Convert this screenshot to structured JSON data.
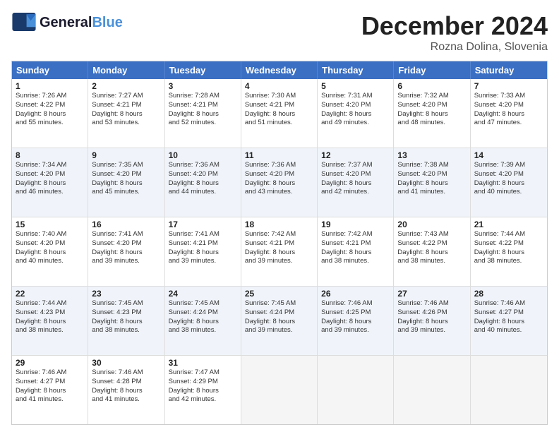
{
  "header": {
    "logo_line1": "General",
    "logo_line2": "Blue",
    "month": "December 2024",
    "location": "Rozna Dolina, Slovenia"
  },
  "days_of_week": [
    "Sunday",
    "Monday",
    "Tuesday",
    "Wednesday",
    "Thursday",
    "Friday",
    "Saturday"
  ],
  "weeks": [
    [
      {
        "day": 1,
        "lines": [
          "Sunrise: 7:26 AM",
          "Sunset: 4:22 PM",
          "Daylight: 8 hours",
          "and 55 minutes."
        ]
      },
      {
        "day": 2,
        "lines": [
          "Sunrise: 7:27 AM",
          "Sunset: 4:21 PM",
          "Daylight: 8 hours",
          "and 53 minutes."
        ]
      },
      {
        "day": 3,
        "lines": [
          "Sunrise: 7:28 AM",
          "Sunset: 4:21 PM",
          "Daylight: 8 hours",
          "and 52 minutes."
        ]
      },
      {
        "day": 4,
        "lines": [
          "Sunrise: 7:30 AM",
          "Sunset: 4:21 PM",
          "Daylight: 8 hours",
          "and 51 minutes."
        ]
      },
      {
        "day": 5,
        "lines": [
          "Sunrise: 7:31 AM",
          "Sunset: 4:20 PM",
          "Daylight: 8 hours",
          "and 49 minutes."
        ]
      },
      {
        "day": 6,
        "lines": [
          "Sunrise: 7:32 AM",
          "Sunset: 4:20 PM",
          "Daylight: 8 hours",
          "and 48 minutes."
        ]
      },
      {
        "day": 7,
        "lines": [
          "Sunrise: 7:33 AM",
          "Sunset: 4:20 PM",
          "Daylight: 8 hours",
          "and 47 minutes."
        ]
      }
    ],
    [
      {
        "day": 8,
        "lines": [
          "Sunrise: 7:34 AM",
          "Sunset: 4:20 PM",
          "Daylight: 8 hours",
          "and 46 minutes."
        ]
      },
      {
        "day": 9,
        "lines": [
          "Sunrise: 7:35 AM",
          "Sunset: 4:20 PM",
          "Daylight: 8 hours",
          "and 45 minutes."
        ]
      },
      {
        "day": 10,
        "lines": [
          "Sunrise: 7:36 AM",
          "Sunset: 4:20 PM",
          "Daylight: 8 hours",
          "and 44 minutes."
        ]
      },
      {
        "day": 11,
        "lines": [
          "Sunrise: 7:36 AM",
          "Sunset: 4:20 PM",
          "Daylight: 8 hours",
          "and 43 minutes."
        ]
      },
      {
        "day": 12,
        "lines": [
          "Sunrise: 7:37 AM",
          "Sunset: 4:20 PM",
          "Daylight: 8 hours",
          "and 42 minutes."
        ]
      },
      {
        "day": 13,
        "lines": [
          "Sunrise: 7:38 AM",
          "Sunset: 4:20 PM",
          "Daylight: 8 hours",
          "and 41 minutes."
        ]
      },
      {
        "day": 14,
        "lines": [
          "Sunrise: 7:39 AM",
          "Sunset: 4:20 PM",
          "Daylight: 8 hours",
          "and 40 minutes."
        ]
      }
    ],
    [
      {
        "day": 15,
        "lines": [
          "Sunrise: 7:40 AM",
          "Sunset: 4:20 PM",
          "Daylight: 8 hours",
          "and 40 minutes."
        ]
      },
      {
        "day": 16,
        "lines": [
          "Sunrise: 7:41 AM",
          "Sunset: 4:20 PM",
          "Daylight: 8 hours",
          "and 39 minutes."
        ]
      },
      {
        "day": 17,
        "lines": [
          "Sunrise: 7:41 AM",
          "Sunset: 4:21 PM",
          "Daylight: 8 hours",
          "and 39 minutes."
        ]
      },
      {
        "day": 18,
        "lines": [
          "Sunrise: 7:42 AM",
          "Sunset: 4:21 PM",
          "Daylight: 8 hours",
          "and 39 minutes."
        ]
      },
      {
        "day": 19,
        "lines": [
          "Sunrise: 7:42 AM",
          "Sunset: 4:21 PM",
          "Daylight: 8 hours",
          "and 38 minutes."
        ]
      },
      {
        "day": 20,
        "lines": [
          "Sunrise: 7:43 AM",
          "Sunset: 4:22 PM",
          "Daylight: 8 hours",
          "and 38 minutes."
        ]
      },
      {
        "day": 21,
        "lines": [
          "Sunrise: 7:44 AM",
          "Sunset: 4:22 PM",
          "Daylight: 8 hours",
          "and 38 minutes."
        ]
      }
    ],
    [
      {
        "day": 22,
        "lines": [
          "Sunrise: 7:44 AM",
          "Sunset: 4:23 PM",
          "Daylight: 8 hours",
          "and 38 minutes."
        ]
      },
      {
        "day": 23,
        "lines": [
          "Sunrise: 7:45 AM",
          "Sunset: 4:23 PM",
          "Daylight: 8 hours",
          "and 38 minutes."
        ]
      },
      {
        "day": 24,
        "lines": [
          "Sunrise: 7:45 AM",
          "Sunset: 4:24 PM",
          "Daylight: 8 hours",
          "and 38 minutes."
        ]
      },
      {
        "day": 25,
        "lines": [
          "Sunrise: 7:45 AM",
          "Sunset: 4:24 PM",
          "Daylight: 8 hours",
          "and 39 minutes."
        ]
      },
      {
        "day": 26,
        "lines": [
          "Sunrise: 7:46 AM",
          "Sunset: 4:25 PM",
          "Daylight: 8 hours",
          "and 39 minutes."
        ]
      },
      {
        "day": 27,
        "lines": [
          "Sunrise: 7:46 AM",
          "Sunset: 4:26 PM",
          "Daylight: 8 hours",
          "and 39 minutes."
        ]
      },
      {
        "day": 28,
        "lines": [
          "Sunrise: 7:46 AM",
          "Sunset: 4:27 PM",
          "Daylight: 8 hours",
          "and 40 minutes."
        ]
      }
    ],
    [
      {
        "day": 29,
        "lines": [
          "Sunrise: 7:46 AM",
          "Sunset: 4:27 PM",
          "Daylight: 8 hours",
          "and 41 minutes."
        ]
      },
      {
        "day": 30,
        "lines": [
          "Sunrise: 7:46 AM",
          "Sunset: 4:28 PM",
          "Daylight: 8 hours",
          "and 41 minutes."
        ]
      },
      {
        "day": 31,
        "lines": [
          "Sunrise: 7:47 AM",
          "Sunset: 4:29 PM",
          "Daylight: 8 hours",
          "and 42 minutes."
        ]
      },
      null,
      null,
      null,
      null
    ]
  ]
}
